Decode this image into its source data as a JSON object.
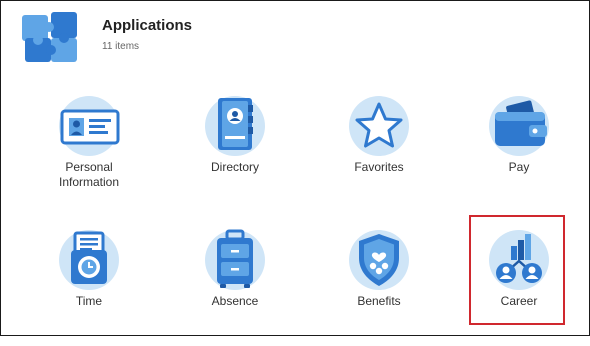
{
  "header": {
    "title": "Applications",
    "subtitle": "11 items",
    "icon": "puzzle-pieces-icon"
  },
  "apps": [
    {
      "label": "Personal\nInformation",
      "icon": "id-card-icon"
    },
    {
      "label": "Directory",
      "icon": "address-book-icon"
    },
    {
      "label": "Favorites",
      "icon": "star-icon"
    },
    {
      "label": "Pay",
      "icon": "wallet-icon"
    },
    {
      "label": "Time",
      "icon": "time-clock-icon"
    },
    {
      "label": "Absence",
      "icon": "luggage-icon"
    },
    {
      "label": "Benefits",
      "icon": "shield-icon"
    },
    {
      "label": "Career",
      "icon": "career-growth-icon"
    }
  ],
  "colors": {
    "icon_bg": "#cfe5f7",
    "icon_blue": "#2f79cf",
    "icon_dark": "#1e5aa6",
    "highlight": "#d0282e"
  }
}
